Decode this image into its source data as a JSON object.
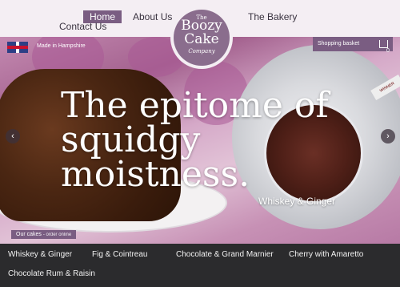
{
  "nav": {
    "home": "Home",
    "about": "About Us",
    "bakery": "The Bakery",
    "contact": "Contact Us"
  },
  "logo": {
    "the": "The",
    "boozy": "Boozy",
    "cake": "Cake",
    "company": "Company"
  },
  "hero": {
    "made_in": "Made in Hampshire",
    "basket": "Shopping basket",
    "basket_count": "0",
    "headline_line1": "The epitome of",
    "headline_line2": "squidgy",
    "headline_line3": "moistness.",
    "caption": "Whiskey & Ginger",
    "our_cakes": "Our cakes",
    "order_online": "- order online",
    "award": "WINNER"
  },
  "menu": {
    "items": [
      "Whiskey & Ginger",
      "Fig & Cointreau",
      "Chocolate & Grand Marnier",
      "Cherry with Amaretto",
      "Chocolate Rum & Raisin"
    ]
  },
  "colors": {
    "accent": "#7a5d82",
    "menu_bg": "#2b2b2d"
  }
}
